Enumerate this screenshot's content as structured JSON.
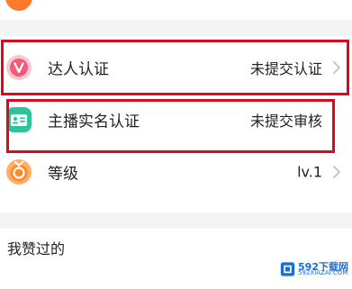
{
  "rows": [
    {
      "label": "达人认证",
      "value": "未提交认证"
    },
    {
      "label": "主播实名认证",
      "value": "未提交审核"
    },
    {
      "label": "等级",
      "value": "lv.1"
    }
  ],
  "section_title": "我赞过的",
  "watermark": {
    "text": "592下载网",
    "sub": "592XIAZAI.COM"
  },
  "colors": {
    "highlight": "#d70a1e",
    "expert_icon": "#f35a78",
    "anchor_icon": "#2ec39c",
    "level_icon": "#ff8a2a"
  }
}
